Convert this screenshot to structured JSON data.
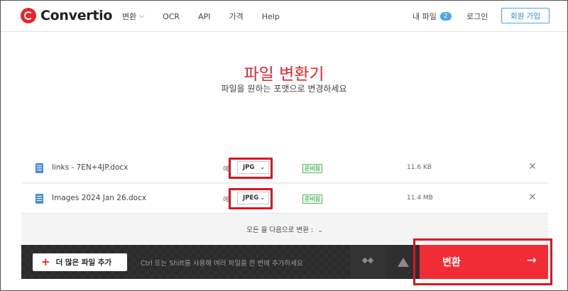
{
  "header": {
    "logo_text": "Convertio",
    "nav": [
      {
        "label": "변환",
        "has_dropdown": true
      },
      {
        "label": "OCR"
      },
      {
        "label": "API"
      },
      {
        "label": "가격"
      },
      {
        "label": "Help"
      }
    ],
    "my_files_label": "내 파일",
    "my_files_count": "2",
    "login_label": "로그인",
    "signup_label": "회원 가입"
  },
  "hero": {
    "title": "파일 변환기",
    "subtitle": "파일을 원하는 포맷으로 변경하세요"
  },
  "files": [
    {
      "name": "links - 7EN+4JP.docx",
      "to_label": "에",
      "format": "JPG",
      "status": "준비됨",
      "size": "11.6 KB"
    },
    {
      "name": "Images 2024 Jan 26.docx",
      "to_label": "에",
      "format": "JPEG",
      "status": "준비됨",
      "size": "11.4 MB"
    }
  ],
  "convert_all_label": "모든 을 다음으로 변환 :",
  "bottom_bar": {
    "add_files_label": "더 많은 파일 추가",
    "hint": "Ctrl 또는 Shift를 사용해 여러 파일을 한 번에 추가하세요",
    "convert_label": "변환"
  },
  "colors": {
    "brand_red": "#e8262f",
    "convert_button": "#f12c36",
    "highlight_box": "#e0141e",
    "bar_dark": "#2b2b2b",
    "link_blue": "#48a9e6",
    "status_green": "#2e9d3a"
  },
  "icons": {
    "logo": "convertio-logo-icon",
    "file": "word-document-icon",
    "remove": "close-icon",
    "dropbox": "dropbox-icon",
    "drive": "google-drive-icon",
    "submit": "arrow-right-icon"
  }
}
